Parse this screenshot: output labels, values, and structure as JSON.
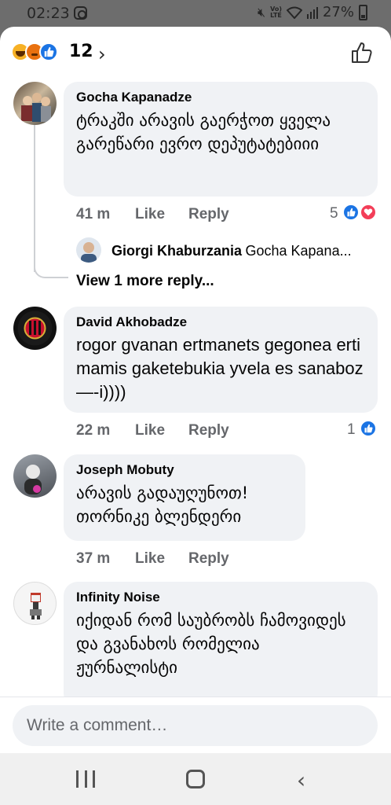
{
  "status_bar": {
    "time": "02:23",
    "battery": "27%",
    "network": "Vo) LTE"
  },
  "header": {
    "reaction_count": "12",
    "reactions": [
      "haha-icon",
      "angry-icon",
      "like-icon"
    ]
  },
  "comments": [
    {
      "author": "Gocha Kapanadze",
      "text": "ტრაკში არავის გაერჭოთ ყველა გარეწარი ევრო დეპუტატებიიი",
      "time": "41 m",
      "like_label": "Like",
      "reply_label": "Reply",
      "reaction_count": "5",
      "reactions": [
        "like-icon",
        "love-icon"
      ],
      "reply_preview": {
        "author": "Giorgi Khaburzania",
        "text": "Gocha Kapana..."
      },
      "view_more": "View 1 more reply..."
    },
    {
      "author": "David Akhobadze",
      "text": "rogor gvanan  ertmanets gegonea erti mamis gaketebukia yvela es sanaboz—-i))))",
      "time": "22 m",
      "like_label": "Like",
      "reply_label": "Reply",
      "reaction_count": "1",
      "reactions": [
        "like-icon"
      ]
    },
    {
      "author": "Joseph Mobuty",
      "text": "არავის გადაუღუნოთ! თორნიკე ბლენდერი",
      "time": "37 m",
      "like_label": "Like",
      "reply_label": "Reply"
    },
    {
      "author": "Infinity Noise",
      "text": "იქიდან რომ საუბრობს ჩამოვიდეს და გვანახოს რომელია ჟურნალისტი"
    }
  ],
  "composer": {
    "placeholder": "Write a comment…"
  },
  "colors": {
    "accent": "#1b74e4",
    "love": "#f33e58",
    "bubble": "#f0f2f5",
    "muted": "#65676b"
  }
}
